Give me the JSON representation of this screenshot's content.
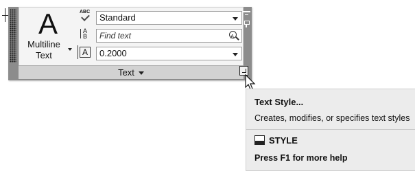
{
  "panel": {
    "multiline_text_label": "Multiline Text",
    "big_glyph": "A",
    "abc_icon_label": "ABC",
    "text_style_value": "Standard",
    "find_text_placeholder": "Find text",
    "text_height_value": "0.2000",
    "panel_title": "Text"
  },
  "tooltip": {
    "title": "Text Style...",
    "description": "Creates, modifies, or specifies text styles",
    "command": "STYLE",
    "help": "Press F1 for more help"
  }
}
